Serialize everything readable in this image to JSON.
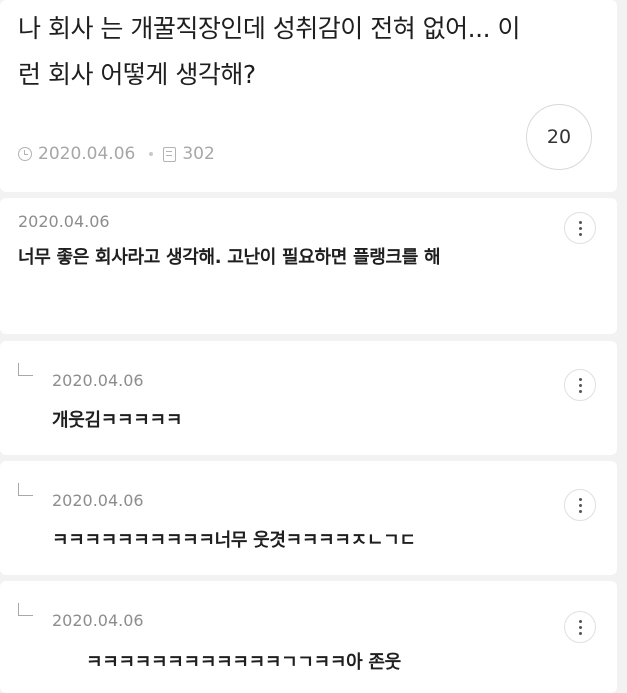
{
  "post": {
    "title": "나 회사 는 개꿀직장인데 성취감이 전혀 없어... 이런 회사 어떻게 생각해?",
    "date": "2020.04.06",
    "views": "302",
    "comment_count": "20"
  },
  "comments": [
    {
      "date": "2020.04.06",
      "text": "너무 좋은 회사라고 생각해. 고난이 필요하면 플랭크를 해"
    }
  ],
  "replies": [
    {
      "date": "2020.04.06",
      "text": "개웃김ㅋㅋㅋㅋㅋ"
    },
    {
      "date": "2020.04.06",
      "text": "ㅋㅋㅋㅋㅋㅋㅋㅋㅋㅋ너무 웃겻ㅋㅋㅋㅋㅈㄴㄱㄷ"
    },
    {
      "date": "2020.04.06",
      "text": "ㅋㅋㅋㅋㅋㅋㅋㅋㅋㅋㅋㅋㄱㄱㅋㅋ아 존웃"
    }
  ]
}
